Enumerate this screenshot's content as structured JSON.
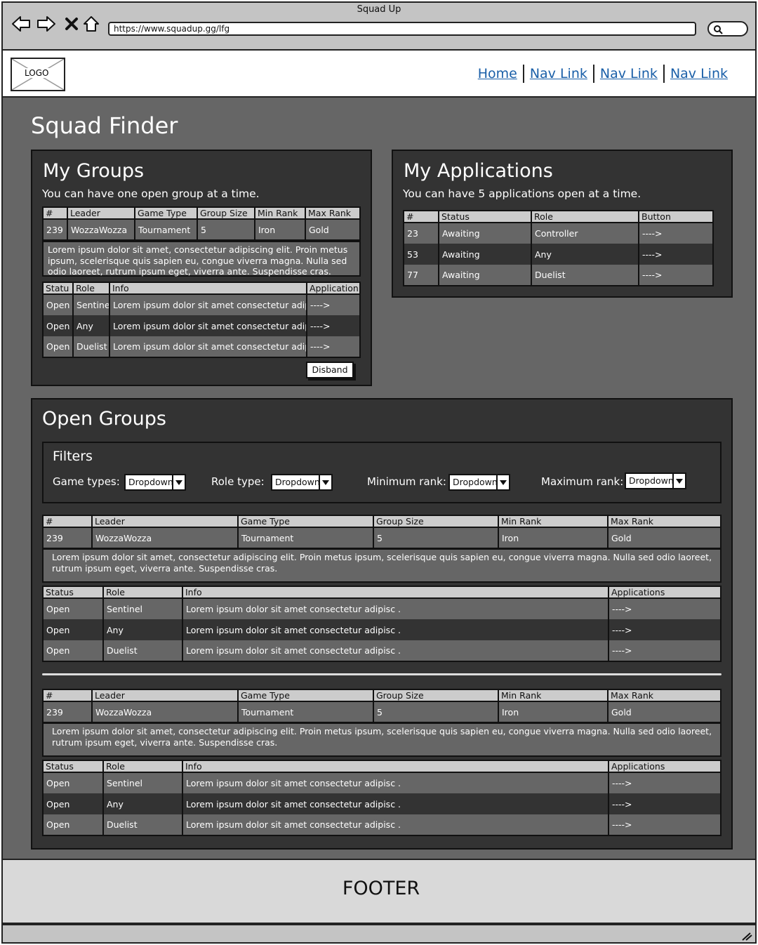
{
  "browser": {
    "window_title": "Squad Up",
    "url": "https://www.squadup.gg/lfg",
    "icons": [
      "back-arrow-icon",
      "forward-arrow-icon",
      "close-icon",
      "home-icon",
      "search-icon"
    ]
  },
  "header": {
    "logo": "LOGO",
    "nav": [
      "Home",
      "Nav Link",
      "Nav Link",
      "Nav Link"
    ]
  },
  "page": {
    "title": "Squad Finder"
  },
  "my_groups": {
    "title": "My Groups",
    "subtitle": "You can have one open group at a time.",
    "group_headers": [
      "#",
      "Leader",
      "Game Type",
      "Group Size",
      "Min Rank",
      "Max Rank"
    ],
    "group_row": [
      "239",
      "WozzaWozza",
      "Tournament",
      "5",
      "Iron",
      "Gold"
    ],
    "description": "Lorem ipsum dolor sit amet, consectetur adipiscing elit. Proin metus ipsum, scelerisque quis sapien eu, congue viverra magna. Nulla sed odio laoreet, rutrum ipsum eget, viverra ante. Suspendisse cras.",
    "slot_headers": [
      "Statu",
      "Role",
      "Info",
      "Application"
    ],
    "slots": [
      [
        "Open",
        "Sentine",
        "Lorem ipsum dolor sit amet consectetur adipis",
        "---->"
      ],
      [
        "Open",
        "Any",
        "Lorem ipsum dolor sit amet consectetur adipis",
        "---->"
      ],
      [
        "Open",
        "Duelist",
        "Lorem ipsum dolor sit amet consectetur adipis",
        "---->"
      ]
    ],
    "disband_label": "Disband"
  },
  "my_applications": {
    "title": "My Applications",
    "subtitle": "You can have 5 applications open at a time.",
    "headers": [
      "#",
      "Status",
      "Role",
      "Button"
    ],
    "rows": [
      [
        "23",
        "Awaiting",
        "Controller",
        "---->"
      ],
      [
        "53",
        "Awaiting",
        "Any",
        "---->"
      ],
      [
        "77",
        "Awaiting",
        "Duelist",
        "---->"
      ]
    ]
  },
  "open_groups": {
    "title": "Open Groups",
    "filters": {
      "title": "Filters",
      "items": [
        {
          "label": "Game types:",
          "value": "Dropdown"
        },
        {
          "label": "Role type:",
          "value": "Dropdown"
        },
        {
          "label": "Minimum rank:",
          "value": "Dropdown"
        },
        {
          "label": "Maximum rank:",
          "value": "Dropdown"
        }
      ]
    },
    "group_headers": [
      "#",
      "Leader",
      "Game Type",
      "Group Size",
      "Min Rank",
      "Max Rank"
    ],
    "slot_headers": [
      "Status",
      "Role",
      "Info",
      "Applications"
    ],
    "groups": [
      {
        "row": [
          "239",
          "WozzaWozza",
          "Tournament",
          "5",
          "Iron",
          "Gold"
        ],
        "description": "Lorem ipsum dolor sit amet, consectetur adipiscing elit. Proin metus ipsum, scelerisque quis sapien eu, congue viverra magna. Nulla sed odio laoreet, rutrum ipsum eget, viverra ante. Suspendisse cras.",
        "slots": [
          [
            "Open",
            "Sentinel",
            "Lorem ipsum dolor sit amet consectetur adipisc .",
            "---->"
          ],
          [
            "Open",
            "Any",
            "Lorem ipsum dolor sit amet consectetur adipisc .",
            "---->"
          ],
          [
            "Open",
            "Duelist",
            "Lorem ipsum dolor sit amet consectetur adipisc .",
            "---->"
          ]
        ]
      },
      {
        "row": [
          "239",
          "WozzaWozza",
          "Tournament",
          "5",
          "Iron",
          "Gold"
        ],
        "description": "Lorem ipsum dolor sit amet, consectetur adipiscing elit. Proin metus ipsum, scelerisque quis sapien eu, congue viverra magna. Nulla sed odio laoreet, rutrum ipsum eget, viverra ante. Suspendisse cras.",
        "slots": [
          [
            "Open",
            "Sentinel",
            "Lorem ipsum dolor sit amet consectetur adipisc .",
            "---->"
          ],
          [
            "Open",
            "Any",
            "Lorem ipsum dolor sit amet consectetur adipisc .",
            "---->"
          ],
          [
            "Open",
            "Duelist",
            "Lorem ipsum dolor sit amet consectetur adipisc .",
            "---->"
          ]
        ]
      }
    ]
  },
  "footer": {
    "text": "FOOTER"
  },
  "colors": {
    "panel": "#333333",
    "main_bg": "#666666",
    "header_row": "#cccccc",
    "link": "#1a5fa8"
  }
}
